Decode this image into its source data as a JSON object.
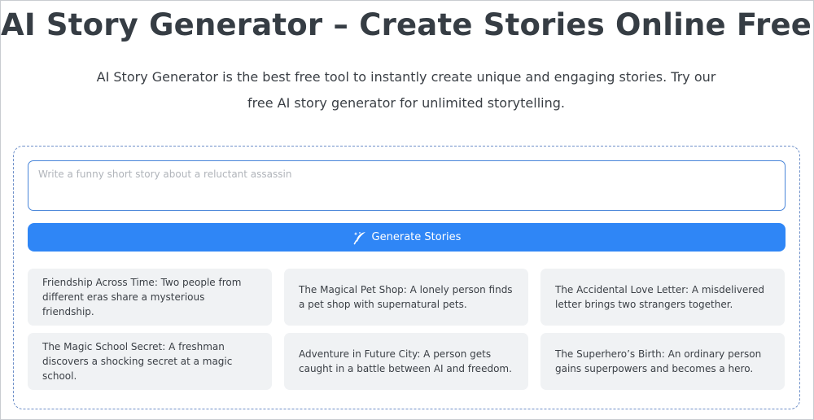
{
  "page": {
    "title": "AI Story Generator – Create Stories Online Free",
    "subtitle": "AI Story Generator is the best free tool to instantly create unique and engaging stories. Try our free AI story generator for unlimited storytelling."
  },
  "generator": {
    "prompt_placeholder": "Write a funny short story about a reluctant assassin",
    "prompt_value": "",
    "generate_label": "Generate Stories",
    "generate_icon": "magic-feather-icon",
    "suggestions": [
      "Friendship Across Time: Two people from different eras share a mysterious friendship.",
      "The Magical Pet Shop: A lonely person finds a pet shop with supernatural pets.",
      "The Accidental Love Letter: A misdelivered letter brings two strangers together.",
      "The Magic School Secret: A freshman discovers a shocking secret at a magic school.",
      "Adventure in Future City: A person gets caught in a battle between AI and freedom.",
      "The Superhero’s Birth: An ordinary person gains superpowers and becomes a hero."
    ]
  },
  "colors": {
    "accent": "#2f86f6",
    "panel_border": "#6f90c9",
    "card_background": "#f0f2f4",
    "title_text": "#363d44"
  }
}
